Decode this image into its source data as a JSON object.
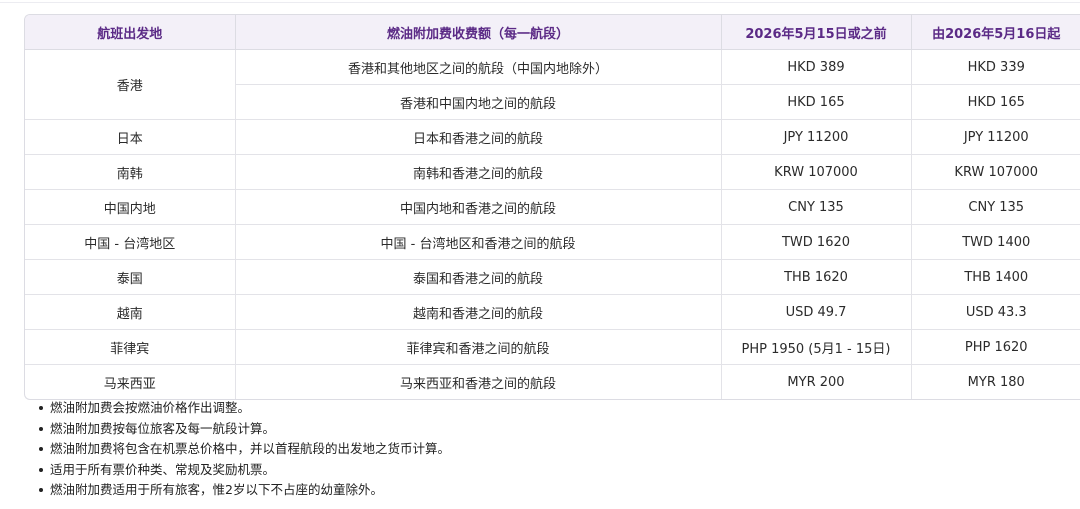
{
  "table": {
    "headers": [
      "航班出发地",
      "燃油附加费收费额（每一航段）",
      "2026年5月15日或之前",
      "由2026年5月16日起"
    ],
    "groups": [
      {
        "origin": "香港",
        "rows": [
          {
            "segment": "香港和其他地区之间的航段（中国内地除外）",
            "before": "HKD 389",
            "after": "HKD 339"
          },
          {
            "segment": "香港和中国内地之间的航段",
            "before": "HKD 165",
            "after": "HKD 165"
          }
        ]
      },
      {
        "origin": "日本",
        "rows": [
          {
            "segment": "日本和香港之间的航段",
            "before": "JPY 11200",
            "after": "JPY 11200"
          }
        ]
      },
      {
        "origin": "南韩",
        "rows": [
          {
            "segment": "南韩和香港之间的航段",
            "before": "KRW 107000",
            "after": "KRW 107000"
          }
        ]
      },
      {
        "origin": "中国内地",
        "rows": [
          {
            "segment": "中国内地和香港之间的航段",
            "before": "CNY 135",
            "after": "CNY 135"
          }
        ]
      },
      {
        "origin": "中国 - 台湾地区",
        "rows": [
          {
            "segment": "中国 - 台湾地区和香港之间的航段",
            "before": "TWD 1620",
            "after": "TWD 1400"
          }
        ]
      },
      {
        "origin": "泰国",
        "rows": [
          {
            "segment": "泰国和香港之间的航段",
            "before": "THB 1620",
            "after": "THB 1400"
          }
        ]
      },
      {
        "origin": "越南",
        "rows": [
          {
            "segment": "越南和香港之间的航段",
            "before": "USD 49.7",
            "after": "USD 43.3"
          }
        ]
      },
      {
        "origin": "菲律宾",
        "rows": [
          {
            "segment": "菲律宾和香港之间的航段",
            "before": "PHP 1950 (5月1 - 15日)",
            "after": "PHP 1620"
          }
        ]
      },
      {
        "origin": "马来西亚",
        "rows": [
          {
            "segment": "马来西亚和香港之间的航段",
            "before": "MYR 200",
            "after": "MYR 180"
          }
        ]
      }
    ]
  },
  "notes": [
    "燃油附加费会按燃油价格作出调整。",
    "燃油附加费按每位旅客及每一航段计算。",
    "燃油附加费将包含在机票总价格中，并以首程航段的出发地之货币计算。",
    "适用于所有票价种类、常规及奖励机票。",
    "燃油附加费适用于所有旅客，惟2岁以下不占座的幼童除外。"
  ]
}
